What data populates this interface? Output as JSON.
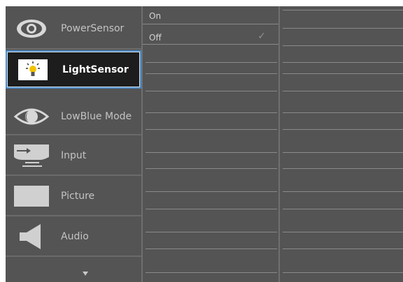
{
  "menu": {
    "items": [
      {
        "label": "PowerSensor",
        "icon": "power-sensor-icon"
      },
      {
        "label": "LightSensor",
        "icon": "light-sensor-icon",
        "selected": true
      },
      {
        "label": "LowBlue Mode",
        "icon": "eye-icon"
      },
      {
        "label": "Input",
        "icon": "input-icon"
      },
      {
        "label": "Picture",
        "icon": "picture-icon"
      },
      {
        "label": "Audio",
        "icon": "speaker-icon"
      }
    ],
    "more_icon": "chevron-down-icon"
  },
  "submenu": {
    "options": [
      {
        "label": "On",
        "checked": false
      },
      {
        "label": "Off",
        "checked": true
      }
    ],
    "check_glyph": "✓"
  },
  "colors": {
    "panel_bg": "#545454",
    "selected_bg": "#1d1d1d",
    "selected_border": "#4a8bc7",
    "text": "#c3c3c3",
    "selected_text": "#ffffff"
  }
}
